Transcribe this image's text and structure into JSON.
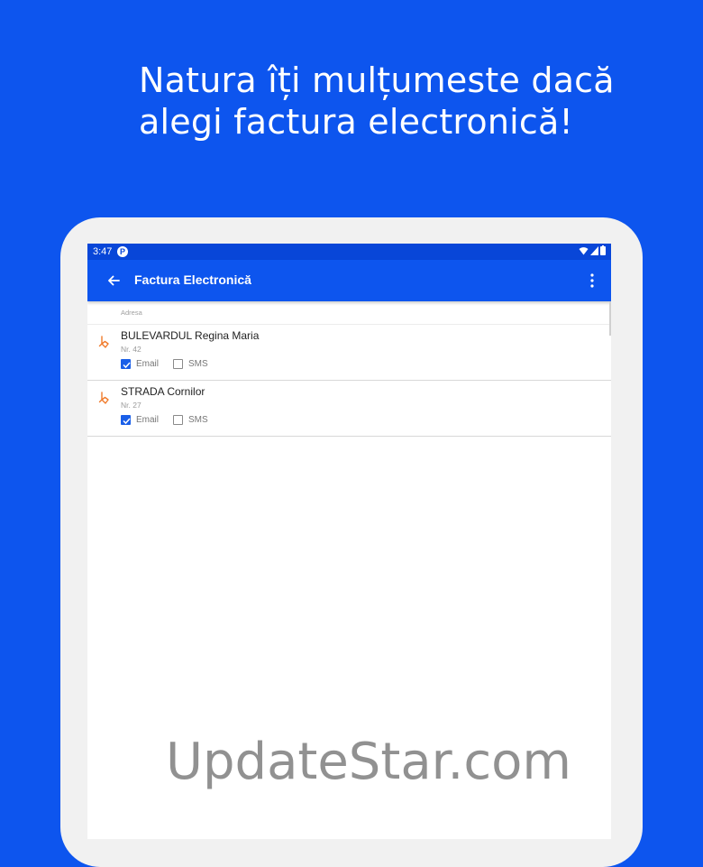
{
  "headline": {
    "line1": "Natura îți mulțumeste dacă",
    "line2": "alegi factura electronică!"
  },
  "statusbar": {
    "time": "3:47",
    "notification_glyph": "P"
  },
  "appbar": {
    "title": "Factura Electronică"
  },
  "list": {
    "header": "Adresa",
    "items": [
      {
        "name": "BULEVARDUL Regina Maria",
        "nr": "Nr. 42",
        "email_label": "Email",
        "email_checked": true,
        "sms_label": "SMS",
        "sms_checked": false
      },
      {
        "name": "STRADA Cornilor",
        "nr": "Nr. 27",
        "email_label": "Email",
        "email_checked": true,
        "sms_label": "SMS",
        "sms_checked": false
      }
    ]
  },
  "watermark": "UpdateStar.com",
  "colors": {
    "brand_blue": "#0d55ee",
    "status_blue": "#0846d8",
    "pin_orange": "#f07a2a",
    "checkbox_blue": "#1a5fe8"
  }
}
